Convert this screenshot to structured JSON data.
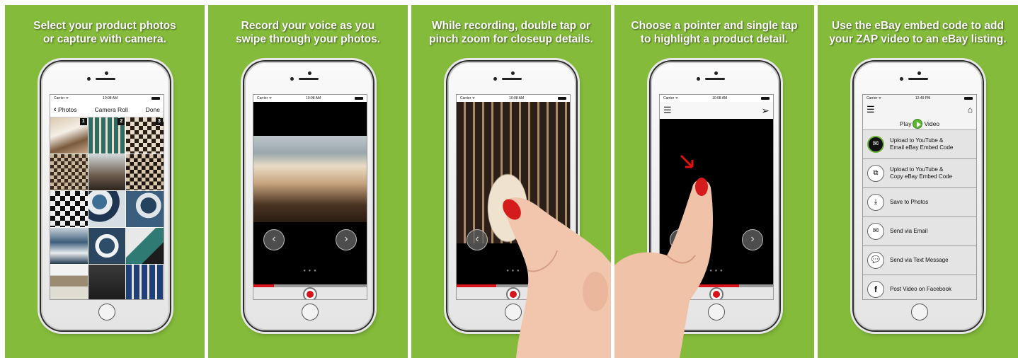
{
  "panels": [
    {
      "caption": [
        "Select your product photos",
        "or capture with camera."
      ],
      "status": {
        "carrier": "Carrier ᯤ",
        "time": "10:08 AM"
      },
      "nav": {
        "back": "Photos",
        "title": "Camera Roll",
        "done": "Done"
      },
      "selected_numbers": [
        "1",
        "2",
        "3"
      ]
    },
    {
      "caption": [
        "Record your voice as you",
        "swipe through your photos."
      ],
      "status": {
        "carrier": "Carrier ᯤ",
        "time": "10:08 AM"
      },
      "progress": 0.18
    },
    {
      "caption": [
        "While recording, double tap or",
        "pinch zoom for closeup details."
      ],
      "status": {
        "carrier": "Carrier ᯤ",
        "time": "10:08 AM"
      },
      "progress": 0.35
    },
    {
      "caption": [
        "Choose a pointer and single tap",
        "to highlight a product detail."
      ],
      "status": {
        "carrier": "Carrier ᯤ",
        "time": "10:08 AM"
      },
      "progress": 0.7
    },
    {
      "caption": [
        "Use the eBay embed code to add",
        "your ZAP video to an eBay listing."
      ],
      "status": {
        "carrier": "Carrier ᯤ",
        "time": "12:49 PM"
      },
      "play_video": {
        "left": "Play",
        "right": "Video"
      },
      "menu": [
        {
          "line1": "Upload to YouTube &",
          "line2": "Email eBay Embed Code",
          "icon": "email-embed-icon"
        },
        {
          "line1": "Upload to YouTube &",
          "line2": "Copy eBay Embed Code",
          "icon": "copy-embed-icon"
        },
        {
          "line1": "Save to Photos",
          "line2": "",
          "icon": "download-icon"
        },
        {
          "line1": "Send via Email",
          "line2": "",
          "icon": "mail-icon"
        },
        {
          "line1": "Send via Text Message",
          "line2": "",
          "icon": "message-icon"
        },
        {
          "line1": "Post Video on Facebook",
          "line2": "",
          "icon": "facebook-icon"
        }
      ]
    }
  ],
  "colors": {
    "panel_bg": "#84bb3a",
    "record_red": "#d8141a",
    "play_green": "#5cb82f"
  }
}
